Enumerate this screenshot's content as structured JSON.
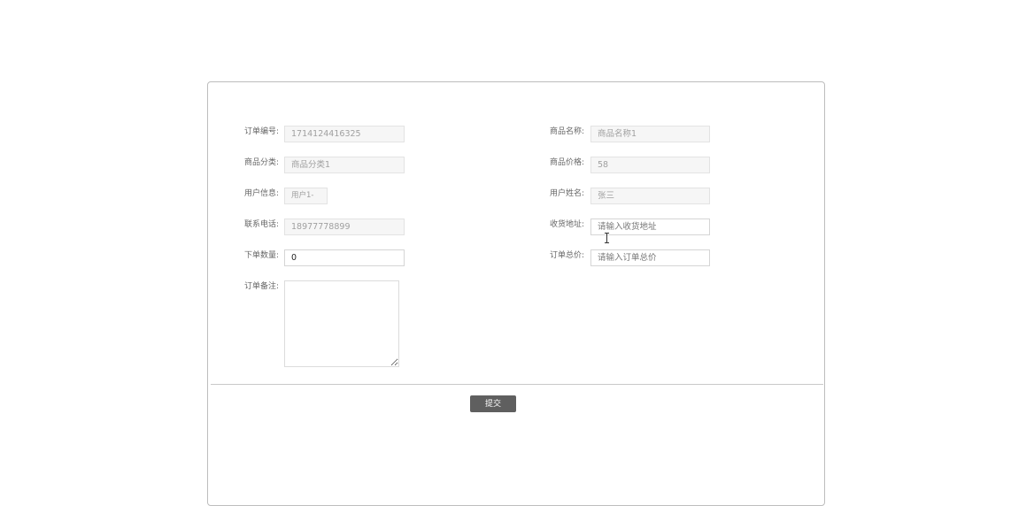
{
  "form": {
    "order_no": {
      "label": "订单编号:",
      "value": "1714124416325"
    },
    "product_name": {
      "label": "商品名称:",
      "value": "商品名称1"
    },
    "product_category": {
      "label": "商品分类:",
      "value": "商品分类1"
    },
    "product_price": {
      "label": "商品价格:",
      "value": "58"
    },
    "user_info": {
      "label": "用户信息:",
      "value": "用户1-"
    },
    "user_name": {
      "label": "用户姓名:",
      "value": "张三"
    },
    "phone": {
      "label": "联系电话:",
      "value": "18977778899"
    },
    "address": {
      "label": "收货地址:",
      "value": "",
      "placeholder": "请输入收货地址"
    },
    "quantity": {
      "label": "下单数量:",
      "value": "0"
    },
    "total_price": {
      "label": "订单总价:",
      "value": "",
      "placeholder": "请输入订单总价"
    },
    "remark": {
      "label": "订单备注:",
      "value": ""
    }
  },
  "actions": {
    "submit_label": "提交"
  }
}
